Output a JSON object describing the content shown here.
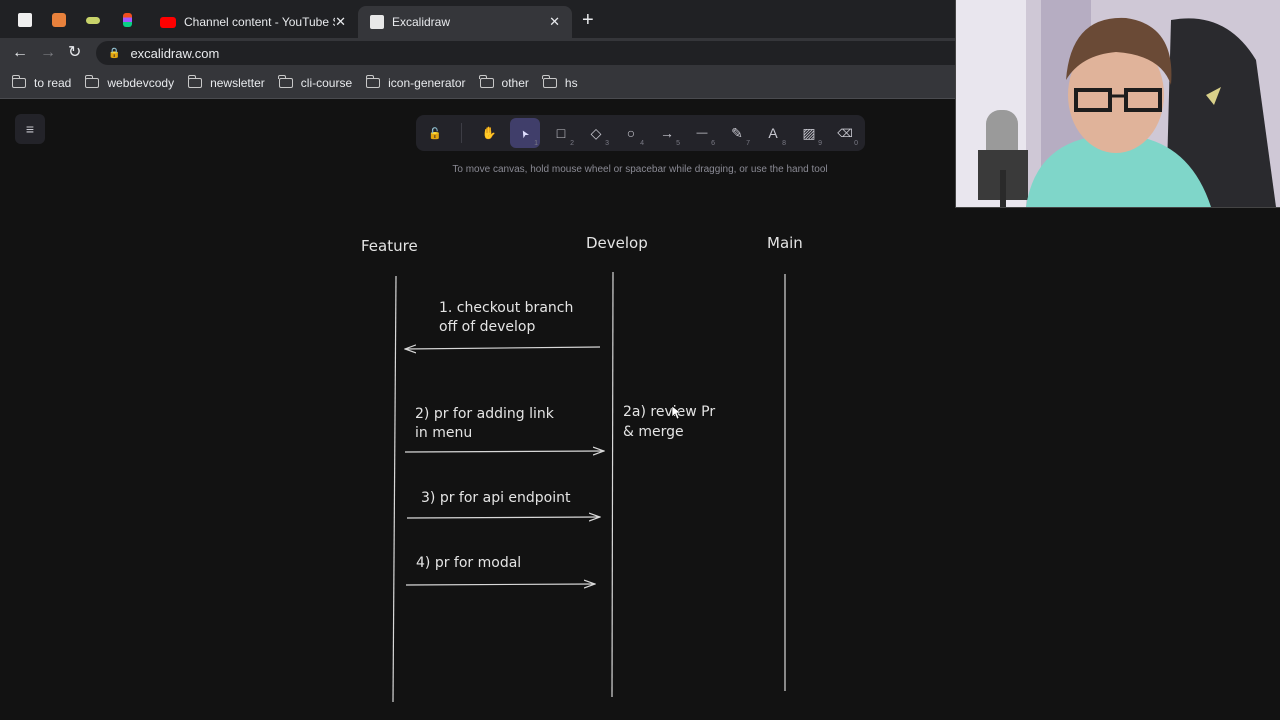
{
  "browser": {
    "tabs": [
      {
        "title": "Channel content - YouTube Stu",
        "active": false
      },
      {
        "title": "Excalidraw",
        "active": true
      }
    ],
    "url": "excalidraw.com",
    "bookmarks": [
      "to read",
      "webdevcody",
      "newsletter",
      "cli-course",
      "icon-generator",
      "other",
      "hs"
    ]
  },
  "excalidraw": {
    "toolbar": [
      {
        "name": "lock",
        "glyph": "🔓",
        "key": ""
      },
      {
        "name": "hand",
        "glyph": "✋",
        "key": ""
      },
      {
        "name": "selection",
        "glyph": "➤",
        "key": "1"
      },
      {
        "name": "rectangle",
        "glyph": "□",
        "key": "2"
      },
      {
        "name": "diamond",
        "glyph": "◇",
        "key": "3"
      },
      {
        "name": "ellipse",
        "glyph": "○",
        "key": "4"
      },
      {
        "name": "arrow",
        "glyph": "→",
        "key": "5"
      },
      {
        "name": "line",
        "glyph": "—",
        "key": "6"
      },
      {
        "name": "draw",
        "glyph": "✎",
        "key": "7"
      },
      {
        "name": "text",
        "glyph": "A",
        "key": "8"
      },
      {
        "name": "image",
        "glyph": "▨",
        "key": "9"
      },
      {
        "name": "eraser",
        "glyph": "⌫",
        "key": "0"
      }
    ],
    "hint": "To move canvas, hold mouse wheel or spacebar while dragging, or use the hand tool",
    "diagram": {
      "headers": {
        "feature": "Feature",
        "develop": "Develop",
        "main": "Main"
      },
      "notes": {
        "step1_line1": "1. checkout branch",
        "step1_line2": "off of develop",
        "step2_line1": "2) pr for adding link",
        "step2_line2": "in menu",
        "step2a_line1": "2a) review Pr",
        "step2a_line2": "& merge",
        "step3": "3) pr for api endpoint",
        "step4": "4) pr for modal"
      }
    }
  },
  "colors": {
    "canvas": "#121212",
    "stroke": "#d8d8d8",
    "active_tool": "#403e6a"
  }
}
